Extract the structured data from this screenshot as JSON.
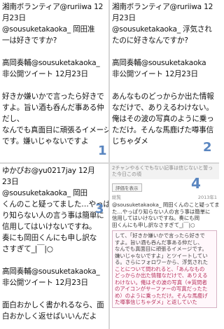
{
  "panels": [
    {
      "number": "1",
      "lines": [
        "湘南ボランティア@ruriiwa 12",
        "月23日",
        "@sousuketakaoka_ 岡田准",
        "一は好きですか?",
        "",
        "高岡奏輔@sousuketakaoka_",
        "非公開ツイート 12月23日",
        "",
        "好きか嫌いかで言ったら好きで",
        "すよ。旨い酒も呑んだ事ある仲",
        "だし、",
        "なんでも真面目に頑張るイメージ",
        "です。嫌いじゃないですよ"
      ]
    },
    {
      "number": "2",
      "lines": [
        "湘南ボランティア@ruriiwa 12",
        "月23日",
        "@sousuketakaoka_ 浮気され",
        "たのに好きなんですか?",
        "",
        "高岡奏輔@sousuketakaoka",
        "非公開ツイート 12月23日",
        "",
        "あんなものどっからか出た情報",
        "なだけで、ありえるわけない。",
        "俺はその波の写真のように乗っ",
        "ただけ。そんな馬鹿げた噂事信",
        "じちゃダメ"
      ]
    },
    {
      "number": "3",
      "lines": [
        "ゆかぴお@yu0217jay 12月",
        "23日",
        "@sousuketakaoka_ 岡田",
        "くんのこと疑ってました…やっぱ",
        "り知らない人の言う事は簡単に",
        "信用してはいけないですね。",
        "奏にも岡田くんにも申し訳な",
        "さすぎて_|￣|○",
        "",
        "高岡奏輔@sousuketakaoka_",
        "非公開ツイート 12月23日",
        "",
        "面白おかしく書かれるなら、面",
        "白おかしく返せばいいんだよ"
      ]
    },
    {
      "number": "4",
      "top_bar": "2チャンやるくでもない記事は信じないと誓った今日この頃",
      "rate_button": "評価を表示",
      "meta_left": "総覧",
      "meta_right": "2013年1",
      "body_lines": [
        "@sousuketakaoka_ 岡田くんのこと疑ってまし",
        "た…やっぱり知らない人の言う事は簡単に",
        "信用してはいけないですね。奏にも岡",
        "田くんにも申し訳なさすぎて_|￣|○"
      ],
      "quote_lines": [
        "して、「好きか嫌いかで言ったら好きで",
        "すよ。旨い酒も呑んだ事ある仲だし、",
        "なんでも真面目に頑張るイメージです。",
        "嫌いじゃないですよ」とツイートしてい",
        "る。さらにフォロワーから、浮気された",
        "ことについて問われると、「あんなもの",
        "どっからか出た情報なだけで、ありえる",
        "わけない。俺はその波の写真（※質問者",
        "のアイコンがサーファーの写真だったた",
        "め）のように乗っただけ。そんな馬鹿げ",
        "た噂事信じちゃダメ」と返していた"
      ]
    }
  ],
  "colors": {
    "number_blue": "#5a86c0",
    "divider": "#d7d7d7",
    "highlight": "#b7315d"
  }
}
